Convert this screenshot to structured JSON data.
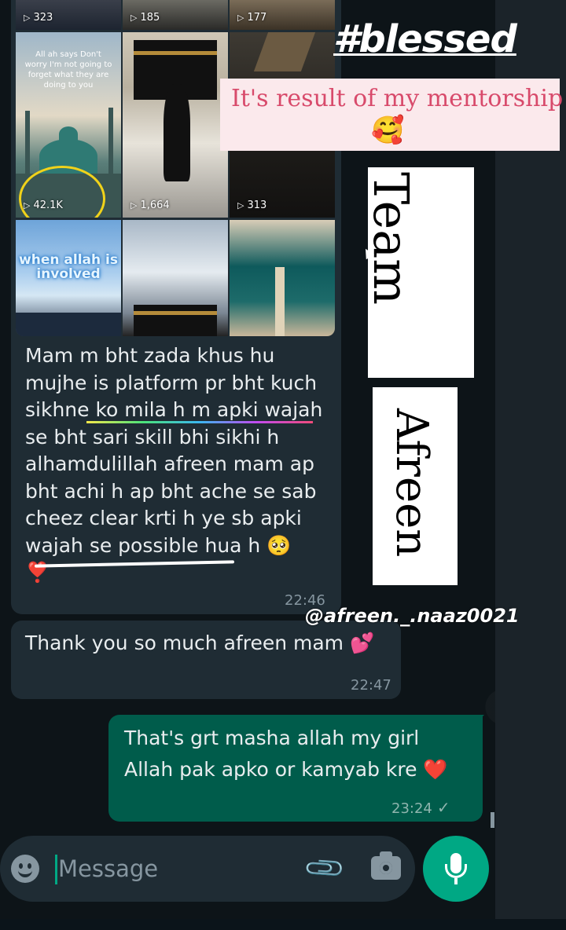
{
  "media": {
    "top_views": [
      "323",
      "185",
      "177"
    ],
    "mid_views": [
      "42.1K",
      "1,664",
      "313"
    ],
    "tile_caption": "All ah says Don't worry I'm not going to forget what they are doing to you",
    "tile_heading": "when allah is involved",
    "play_glyph": "▷"
  },
  "message_in_1": {
    "text": "Mam m bht zada khus hu mujhe is platform pr bht kuch sikhne ko mila h m apki wajah se bht sari skill bhi sikhi h alhamdulillah afreen mam ap bht achi h ap bht ache se sab cheez clear krti h ye sb apki wajah se possible hua h 🥺",
    "heart": "❣️",
    "time": "22:46"
  },
  "message_in_2": {
    "text": "Thank you so much afreen mam 💕",
    "time": "22:47"
  },
  "message_out": {
    "line1": "That's grt masha allah my girl",
    "line2": "Allah pak apko or kamyab kre ❤️",
    "time": "23:24",
    "status": "✓"
  },
  "overlay": {
    "hashtag": "#blessed",
    "mentor_text": "It's result of my mentorship",
    "mentor_emoji": "🥰",
    "team": "Team",
    "afreen": "Afreen",
    "handle": "@afreen._.naaz0021"
  },
  "composer": {
    "placeholder": "Message",
    "attach_glyph": "📎"
  },
  "colors": {
    "incoming_bubble": "#1f2c34",
    "outgoing_bubble": "#005c4b",
    "accent": "#00a884",
    "mentor_text": "#d84a6b"
  },
  "icons": [
    "emoji-icon",
    "attach-icon",
    "camera-icon",
    "mic-icon",
    "play-icon",
    "read-check-icon"
  ]
}
